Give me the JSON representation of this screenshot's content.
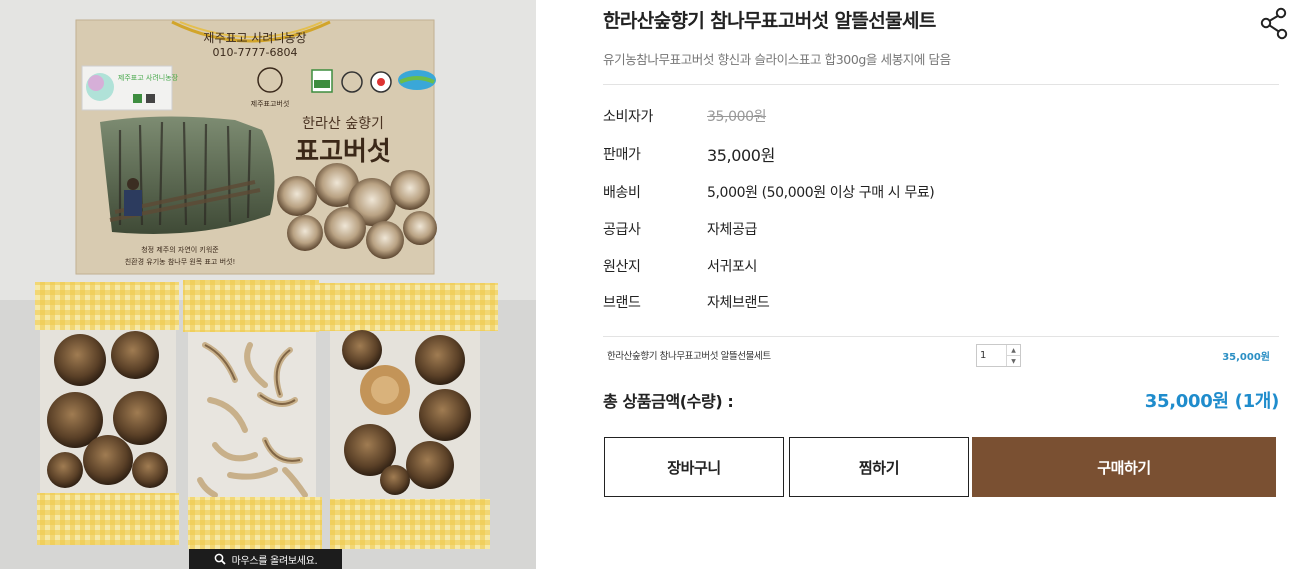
{
  "image": {
    "alt": "",
    "box_texts": {
      "farm_name": "제주표고 사려니농장",
      "phone": "010-7777-6804",
      "tagline": "한라산 숲향기",
      "product": "표고버섯",
      "sticker": "제주표고 사려니농장",
      "logo_caption": "제주표고버섯",
      "slogan_line1": "청정 제주의 자연이 키워준",
      "slogan_line2": "친환경 유기농 참나무 원목 표고 버섯!"
    },
    "zoom_hint": "마우스를 올려보세요."
  },
  "product": {
    "title": "한라산숲향기 참나무표고버섯 알뜰선물세트",
    "subtitle": "유기농참나무표고버섯 향신과 슬라이스표고 합300g을 세봉지에 담음"
  },
  "info": [
    {
      "label": "소비자가",
      "value": "35,000원",
      "style": "strike"
    },
    {
      "label": "판매가",
      "value": "35,000원",
      "style": "big"
    },
    {
      "label": "배송비",
      "value": "5,000원 (50,000원 이상 구매 시 무료)",
      "style": ""
    },
    {
      "label": "공급사",
      "value": "자체공급",
      "style": ""
    },
    {
      "label": "원산지",
      "value": "서귀포시",
      "style": ""
    },
    {
      "label": "브랜드",
      "value": "자체브랜드",
      "style": ""
    }
  ],
  "option": {
    "name": "한라산숲향기 참나무표고버섯 알뜰선물세트",
    "quantity": "1",
    "up_symbol": "▲",
    "down_symbol": "▼",
    "price": "35,000원"
  },
  "total": {
    "label": "총 상품금액(수량) :",
    "value": "35,000원 (1개)"
  },
  "buttons": {
    "cart": "장바구니",
    "wish": "찜하기",
    "buy": "구매하기"
  },
  "colors": {
    "accent_blue": "#1f8ccc",
    "buy_button": "#7a5032",
    "strike_gray": "#999999"
  },
  "icons": {
    "share": "share-icon",
    "zoom": "magnifier-icon"
  }
}
